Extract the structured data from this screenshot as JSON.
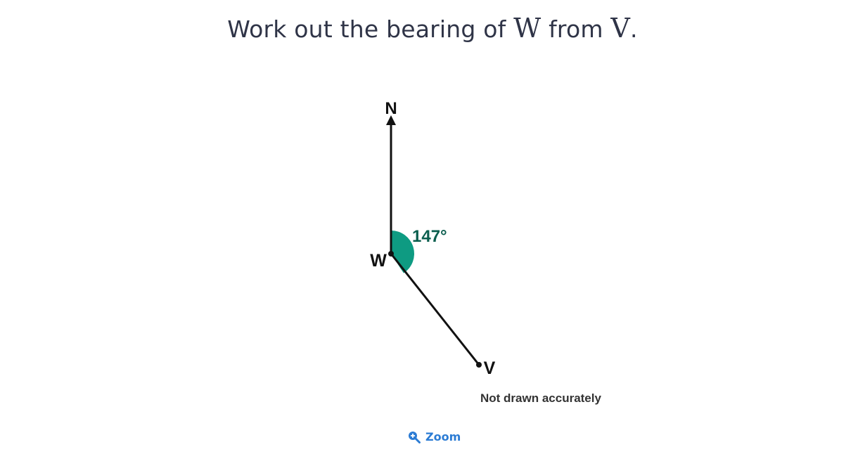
{
  "question": {
    "prefix": "Work out the bearing of ",
    "point_to": "W",
    "middle": " from ",
    "point_from": "V",
    "suffix": "."
  },
  "diagram": {
    "north_label": "N",
    "point_w_label": "W",
    "point_v_label": "V",
    "angle_label": "147°",
    "bearing_degrees": 147,
    "note": "Not drawn accurately",
    "colors": {
      "line": "#111111",
      "angle_fill": "#0e9b82",
      "angle_text": "#0b5e4e",
      "note_text": "#333333"
    }
  },
  "zoom": {
    "label": "Zoom",
    "icon": "zoom-in-icon",
    "color": "#2c7cd4"
  }
}
